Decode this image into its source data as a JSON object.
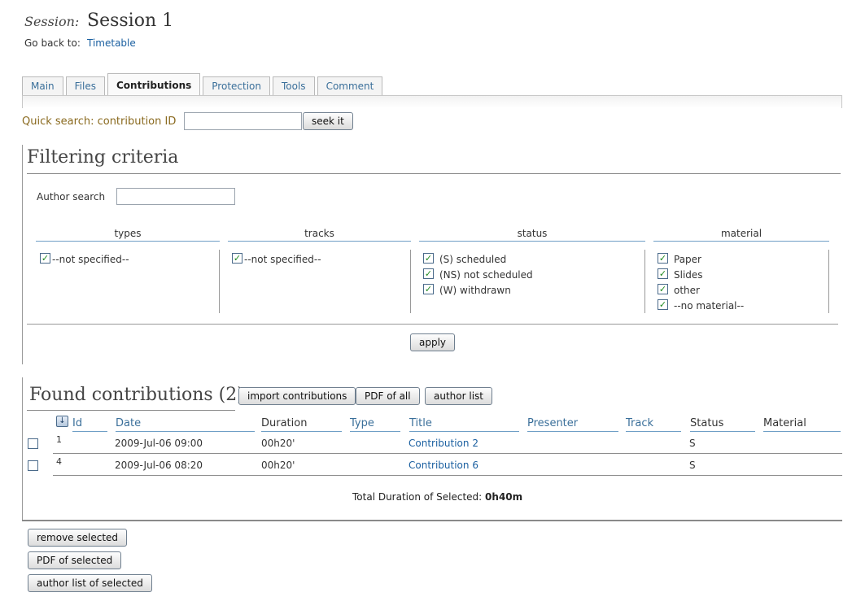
{
  "header": {
    "session_label": "Session:",
    "session_title": "Session 1",
    "goback_label": "Go back to:",
    "goback_link": "Timetable"
  },
  "tabs": [
    {
      "label": "Main",
      "active": false
    },
    {
      "label": "Files",
      "active": false
    },
    {
      "label": "Contributions",
      "active": true
    },
    {
      "label": "Protection",
      "active": false
    },
    {
      "label": "Tools",
      "active": false
    },
    {
      "label": "Comment",
      "active": false
    }
  ],
  "quick_search": {
    "label": "Quick search: contribution ID",
    "value": "",
    "button": "seek it"
  },
  "filtering": {
    "title": "Filtering criteria",
    "author_search_label": "Author search",
    "author_search_value": "",
    "columns": {
      "types": {
        "header": "types",
        "options": [
          {
            "label": "--not specified--",
            "checked": true
          }
        ]
      },
      "tracks": {
        "header": "tracks",
        "options": [
          {
            "label": "--not specified--",
            "checked": true
          }
        ]
      },
      "status": {
        "header": "status",
        "options": [
          {
            "label": "(S) scheduled",
            "checked": true
          },
          {
            "label": "(NS) not scheduled",
            "checked": true
          },
          {
            "label": "(W) withdrawn",
            "checked": true
          }
        ]
      },
      "material": {
        "header": "material",
        "options": [
          {
            "label": "Paper",
            "checked": true
          },
          {
            "label": "Slides",
            "checked": true
          },
          {
            "label": "other",
            "checked": true
          },
          {
            "label": "--no material--",
            "checked": true
          }
        ]
      }
    },
    "apply_button": "apply"
  },
  "found": {
    "title": "Found contributions (2)",
    "import_button": "import contributions",
    "pdf_all_button": "PDF of all",
    "author_list_button": "author list",
    "columns": {
      "id": "Id",
      "date": "Date",
      "duration": "Duration",
      "type": "Type",
      "title": "Title",
      "presenter": "Presenter",
      "track": "Track",
      "status": "Status",
      "material": "Material"
    },
    "rows": [
      {
        "id": "1",
        "date": "2009-Jul-06 09:00",
        "duration": "00h20'",
        "type": "",
        "title": "Contribution 2",
        "presenter": "",
        "track": "",
        "status": "S",
        "material": ""
      },
      {
        "id": "4",
        "date": "2009-Jul-06 08:20",
        "duration": "00h20'",
        "type": "",
        "title": "Contribution 6",
        "presenter": "",
        "track": "",
        "status": "S",
        "material": ""
      }
    ],
    "total_label": "Total Duration of Selected:",
    "total_value": "0h40m"
  },
  "actions": {
    "remove_selected": "remove selected",
    "pdf_selected": "PDF of selected",
    "author_list_selected": "author list of selected"
  }
}
